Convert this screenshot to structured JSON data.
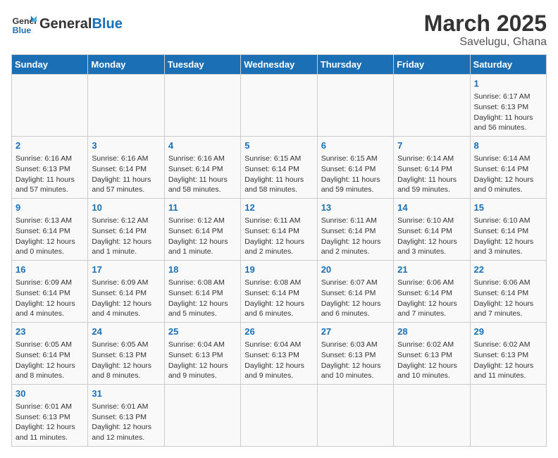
{
  "header": {
    "logo_general": "General",
    "logo_blue": "Blue",
    "month_title": "March 2025",
    "location": "Savelugu, Ghana"
  },
  "days_of_week": [
    "Sunday",
    "Monday",
    "Tuesday",
    "Wednesday",
    "Thursday",
    "Friday",
    "Saturday"
  ],
  "weeks": [
    [
      {
        "day": "",
        "info": ""
      },
      {
        "day": "",
        "info": ""
      },
      {
        "day": "",
        "info": ""
      },
      {
        "day": "",
        "info": ""
      },
      {
        "day": "",
        "info": ""
      },
      {
        "day": "",
        "info": ""
      },
      {
        "day": "1",
        "info": "Sunrise: 6:17 AM\nSunset: 6:13 PM\nDaylight: 11 hours and 56 minutes."
      }
    ],
    [
      {
        "day": "2",
        "info": "Sunrise: 6:16 AM\nSunset: 6:13 PM\nDaylight: 11 hours and 57 minutes."
      },
      {
        "day": "3",
        "info": "Sunrise: 6:16 AM\nSunset: 6:14 PM\nDaylight: 11 hours and 57 minutes."
      },
      {
        "day": "4",
        "info": "Sunrise: 6:16 AM\nSunset: 6:14 PM\nDaylight: 11 hours and 58 minutes."
      },
      {
        "day": "5",
        "info": "Sunrise: 6:15 AM\nSunset: 6:14 PM\nDaylight: 11 hours and 58 minutes."
      },
      {
        "day": "6",
        "info": "Sunrise: 6:15 AM\nSunset: 6:14 PM\nDaylight: 11 hours and 59 minutes."
      },
      {
        "day": "7",
        "info": "Sunrise: 6:14 AM\nSunset: 6:14 PM\nDaylight: 11 hours and 59 minutes."
      },
      {
        "day": "8",
        "info": "Sunrise: 6:14 AM\nSunset: 6:14 PM\nDaylight: 12 hours and 0 minutes."
      }
    ],
    [
      {
        "day": "9",
        "info": "Sunrise: 6:13 AM\nSunset: 6:14 PM\nDaylight: 12 hours and 0 minutes."
      },
      {
        "day": "10",
        "info": "Sunrise: 6:12 AM\nSunset: 6:14 PM\nDaylight: 12 hours and 1 minute."
      },
      {
        "day": "11",
        "info": "Sunrise: 6:12 AM\nSunset: 6:14 PM\nDaylight: 12 hours and 1 minute."
      },
      {
        "day": "12",
        "info": "Sunrise: 6:11 AM\nSunset: 6:14 PM\nDaylight: 12 hours and 2 minutes."
      },
      {
        "day": "13",
        "info": "Sunrise: 6:11 AM\nSunset: 6:14 PM\nDaylight: 12 hours and 2 minutes."
      },
      {
        "day": "14",
        "info": "Sunrise: 6:10 AM\nSunset: 6:14 PM\nDaylight: 12 hours and 3 minutes."
      },
      {
        "day": "15",
        "info": "Sunrise: 6:10 AM\nSunset: 6:14 PM\nDaylight: 12 hours and 3 minutes."
      }
    ],
    [
      {
        "day": "16",
        "info": "Sunrise: 6:09 AM\nSunset: 6:14 PM\nDaylight: 12 hours and 4 minutes."
      },
      {
        "day": "17",
        "info": "Sunrise: 6:09 AM\nSunset: 6:14 PM\nDaylight: 12 hours and 4 minutes."
      },
      {
        "day": "18",
        "info": "Sunrise: 6:08 AM\nSunset: 6:14 PM\nDaylight: 12 hours and 5 minutes."
      },
      {
        "day": "19",
        "info": "Sunrise: 6:08 AM\nSunset: 6:14 PM\nDaylight: 12 hours and 6 minutes."
      },
      {
        "day": "20",
        "info": "Sunrise: 6:07 AM\nSunset: 6:14 PM\nDaylight: 12 hours and 6 minutes."
      },
      {
        "day": "21",
        "info": "Sunrise: 6:06 AM\nSunset: 6:14 PM\nDaylight: 12 hours and 7 minutes."
      },
      {
        "day": "22",
        "info": "Sunrise: 6:06 AM\nSunset: 6:14 PM\nDaylight: 12 hours and 7 minutes."
      }
    ],
    [
      {
        "day": "23",
        "info": "Sunrise: 6:05 AM\nSunset: 6:14 PM\nDaylight: 12 hours and 8 minutes."
      },
      {
        "day": "24",
        "info": "Sunrise: 6:05 AM\nSunset: 6:13 PM\nDaylight: 12 hours and 8 minutes."
      },
      {
        "day": "25",
        "info": "Sunrise: 6:04 AM\nSunset: 6:13 PM\nDaylight: 12 hours and 9 minutes."
      },
      {
        "day": "26",
        "info": "Sunrise: 6:04 AM\nSunset: 6:13 PM\nDaylight: 12 hours and 9 minutes."
      },
      {
        "day": "27",
        "info": "Sunrise: 6:03 AM\nSunset: 6:13 PM\nDaylight: 12 hours and 10 minutes."
      },
      {
        "day": "28",
        "info": "Sunrise: 6:02 AM\nSunset: 6:13 PM\nDaylight: 12 hours and 10 minutes."
      },
      {
        "day": "29",
        "info": "Sunrise: 6:02 AM\nSunset: 6:13 PM\nDaylight: 12 hours and 11 minutes."
      }
    ],
    [
      {
        "day": "30",
        "info": "Sunrise: 6:01 AM\nSunset: 6:13 PM\nDaylight: 12 hours and 11 minutes."
      },
      {
        "day": "31",
        "info": "Sunrise: 6:01 AM\nSunset: 6:13 PM\nDaylight: 12 hours and 12 minutes."
      },
      {
        "day": "",
        "info": ""
      },
      {
        "day": "",
        "info": ""
      },
      {
        "day": "",
        "info": ""
      },
      {
        "day": "",
        "info": ""
      },
      {
        "day": "",
        "info": ""
      }
    ]
  ]
}
